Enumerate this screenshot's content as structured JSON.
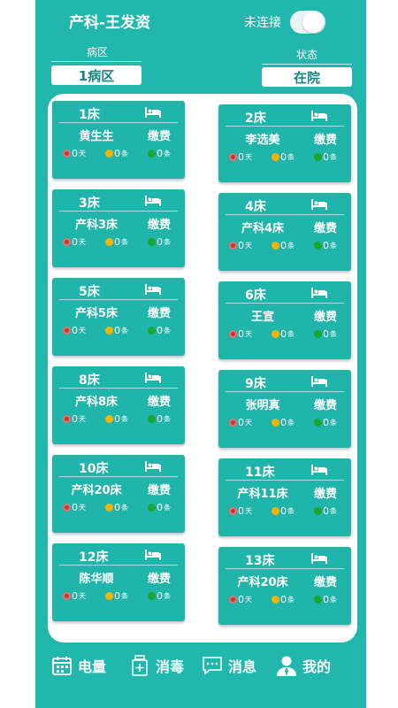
{
  "header": {
    "title": "产科-王发资",
    "connection_label": "未连接"
  },
  "filters": {
    "ward_label": "病区",
    "ward_value": "1病区",
    "status_label": "状态",
    "status_value": "在院"
  },
  "beds": [
    {
      "bed": "1床",
      "name": "黄生生",
      "pay": "缴费",
      "days": "0",
      "days_unit": "天",
      "yellow": "0",
      "yellow_unit": "条",
      "green": "0",
      "green_unit": "条"
    },
    {
      "bed": "2床",
      "name": "李选美",
      "pay": "缴费",
      "days": "0",
      "days_unit": "天",
      "yellow": "0",
      "yellow_unit": "条",
      "green": "0",
      "green_unit": "条"
    },
    {
      "bed": "3床",
      "name": "产科3床",
      "pay": "缴费",
      "days": "0",
      "days_unit": "天",
      "yellow": "0",
      "yellow_unit": "条",
      "green": "0",
      "green_unit": "条"
    },
    {
      "bed": "4床",
      "name": "产科4床",
      "pay": "缴费",
      "days": "0",
      "days_unit": "天",
      "yellow": "0",
      "yellow_unit": "条",
      "green": "0",
      "green_unit": "条"
    },
    {
      "bed": "5床",
      "name": "产科5床",
      "pay": "缴费",
      "days": "0",
      "days_unit": "天",
      "yellow": "0",
      "yellow_unit": "条",
      "green": "0",
      "green_unit": "条"
    },
    {
      "bed": "6床",
      "name": "王宣",
      "pay": "缴费",
      "days": "0",
      "days_unit": "天",
      "yellow": "0",
      "yellow_unit": "条",
      "green": "0",
      "green_unit": "条"
    },
    {
      "bed": "8床",
      "name": "产科8床",
      "pay": "缴费",
      "days": "0",
      "days_unit": "天",
      "yellow": "0",
      "yellow_unit": "条",
      "green": "0",
      "green_unit": "条"
    },
    {
      "bed": "9床",
      "name": "张明真",
      "pay": "缴费",
      "days": "0",
      "days_unit": "天",
      "yellow": "0",
      "yellow_unit": "条",
      "green": "0",
      "green_unit": "条"
    },
    {
      "bed": "10床",
      "name": "产科20床",
      "pay": "缴费",
      "days": "0",
      "days_unit": "天",
      "yellow": "0",
      "yellow_unit": "条",
      "green": "0",
      "green_unit": "条"
    },
    {
      "bed": "11床",
      "name": "产科11床",
      "pay": "缴费",
      "days": "0",
      "days_unit": "天",
      "yellow": "0",
      "yellow_unit": "条",
      "green": "0",
      "green_unit": "条"
    },
    {
      "bed": "12床",
      "name": "陈华顺",
      "pay": "缴费",
      "days": "0",
      "days_unit": "天",
      "yellow": "0",
      "yellow_unit": "条",
      "green": "0",
      "green_unit": "条"
    },
    {
      "bed": "13床",
      "name": "产科20床",
      "pay": "缴费",
      "days": "0",
      "days_unit": "天",
      "yellow": "0",
      "yellow_unit": "条",
      "green": "0",
      "green_unit": "条"
    }
  ],
  "nav": {
    "power_label": "电量",
    "power_icon": "calendar-icon",
    "disinfect_label": "消毒",
    "disinfect_icon": "medicine-bottle-icon",
    "message_label": "消息",
    "message_icon": "chat-bubble-icon",
    "mine_label": "我的",
    "mine_icon": "user-icon"
  }
}
